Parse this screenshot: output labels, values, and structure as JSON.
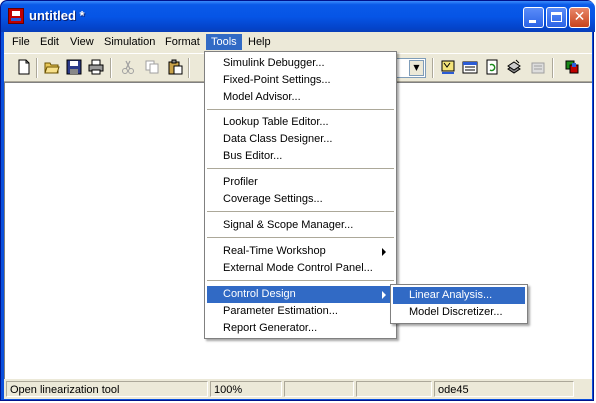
{
  "window": {
    "title": "untitled *",
    "controls": {
      "minimize": "minimize",
      "maximize": "maximize",
      "close": "✕"
    }
  },
  "menubar": {
    "items": [
      "File",
      "Edit",
      "View",
      "Simulation",
      "Format",
      "Tools",
      "Help"
    ],
    "active": "Tools"
  },
  "toolbar": {
    "icons": [
      "new-icon",
      "open-icon",
      "save-icon",
      "print-icon",
      "cut-icon",
      "copy-icon",
      "paste-icon",
      "library-browser-icon",
      "model-explorer-icon",
      "refresh-icon",
      "build-icon",
      "debug-icon",
      "port-values-icon"
    ]
  },
  "tools_menu": {
    "items": [
      {
        "label": "Simulink Debugger..."
      },
      {
        "label": "Fixed-Point Settings..."
      },
      {
        "label": "Model Advisor..."
      },
      {
        "label": "Lookup Table Editor..."
      },
      {
        "label": "Data Class Designer..."
      },
      {
        "label": "Bus Editor..."
      },
      {
        "label": "Profiler"
      },
      {
        "label": "Coverage Settings..."
      },
      {
        "label": "Signal & Scope Manager..."
      },
      {
        "label": "Real-Time Workshop"
      },
      {
        "label": "External Mode Control Panel..."
      },
      {
        "label": "Control Design"
      },
      {
        "label": "Parameter Estimation..."
      },
      {
        "label": "Report Generator..."
      }
    ]
  },
  "control_design_submenu": {
    "items": [
      {
        "label": "Linear Analysis..."
      },
      {
        "label": "Model Discretizer..."
      }
    ]
  },
  "statusbar": {
    "message": "Open linearization tool",
    "zoom": "100%",
    "solver": "ode45"
  },
  "colors": {
    "titlebar": "#0655e6",
    "menu_highlight": "#316ac5",
    "chrome": "#ece9d8"
  }
}
